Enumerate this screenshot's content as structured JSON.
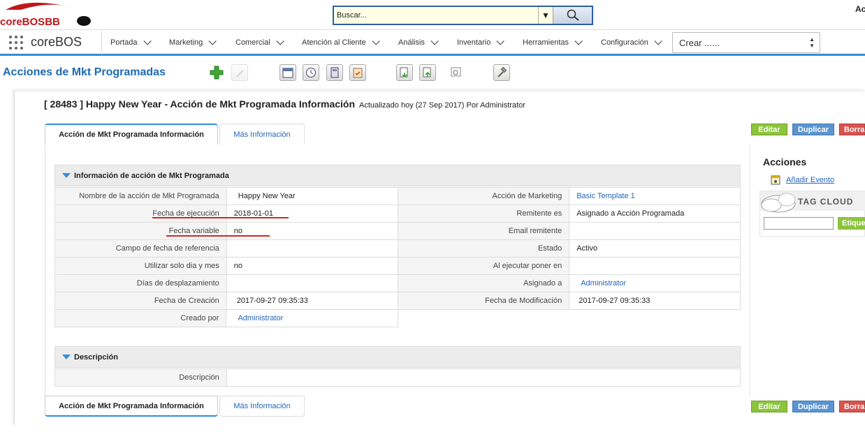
{
  "header": {
    "logo_text": "coreBOSBB",
    "search_placeholder": "Buscar...",
    "top_right_fragment": "Ac"
  },
  "nav": {
    "brand": "coreBOS",
    "items": [
      {
        "label": "Portada"
      },
      {
        "label": "Marketing"
      },
      {
        "label": "Comercial"
      },
      {
        "label": "Atención al Cliente"
      },
      {
        "label": "Análisis"
      },
      {
        "label": "Inventario"
      },
      {
        "label": "Herramientas"
      },
      {
        "label": "Configuración"
      }
    ],
    "crear": "Crear ......"
  },
  "module": {
    "title": "Acciones de Mkt Programadas",
    "toolbar_icons": [
      "add-icon",
      "edit-disabled-icon",
      "calendar-icon",
      "clock-icon",
      "calculator-icon",
      "clipboard-icon",
      "import-icon",
      "export-icon",
      "find-duplicates-icon",
      "settings-hammer-icon"
    ]
  },
  "record": {
    "title": "[ 28483 ] Happy New Year - Acción de Mkt Programada Información",
    "updated": "Actualizado hoy (27 Sep 2017) Por Administrator"
  },
  "tabs": {
    "info": "Acción de Mkt Programada Información",
    "more": "Más Información"
  },
  "buttons": {
    "edit": "Editar",
    "duplicate": "Duplicar",
    "delete": "Borra"
  },
  "section_info": {
    "title": "Información de acción de Mkt Programada",
    "rows": [
      {
        "l1": "Nombre de la acción de Mkt Programada",
        "v1": "Happy New Year",
        "l2": "Acción de Marketing",
        "v2": "Basic Template 1"
      },
      {
        "l1": "Fecha de ejecución",
        "v1": "2018-01-01",
        "l2": "Remitente es",
        "v2": "Asignado a Acción Programada"
      },
      {
        "l1": "Fecha variable",
        "v1": "no",
        "l2": "Email remitente",
        "v2": ""
      },
      {
        "l1": "Campo de fecha de referencia",
        "v1": "",
        "l2": "Estado",
        "v2": "Activo"
      },
      {
        "l1": "Utilizar solo dia y mes",
        "v1": "no",
        "l2": "Al ejecutar poner en",
        "v2": ""
      },
      {
        "l1": "Días de desplazamiento",
        "v1": "",
        "l2": "Asignado a",
        "v2": "Administrator"
      },
      {
        "l1": "Fecha de Creación",
        "v1": "2017-09-27 09:35:33",
        "l2": "Fecha de Modificación",
        "v2": "2017-09-27 09:35:33"
      }
    ],
    "last_row": {
      "l1": "Creado por",
      "v1": "Administrator"
    }
  },
  "section_desc": {
    "title": "Descripción",
    "label": "Descripción",
    "value": ""
  },
  "sidebar": {
    "title": "Acciones",
    "add_event": "Añadir Evento",
    "tag_cloud": "TAG CLOUD",
    "tag_button": "Etique"
  },
  "colors": {
    "accent_blue": "#2f8fd1",
    "title_blue": "#1f6ab3",
    "btn_green": "#8cc43c",
    "btn_blue": "#5a95d2",
    "btn_red": "#d9534f",
    "annotation_red": "#e02020"
  }
}
